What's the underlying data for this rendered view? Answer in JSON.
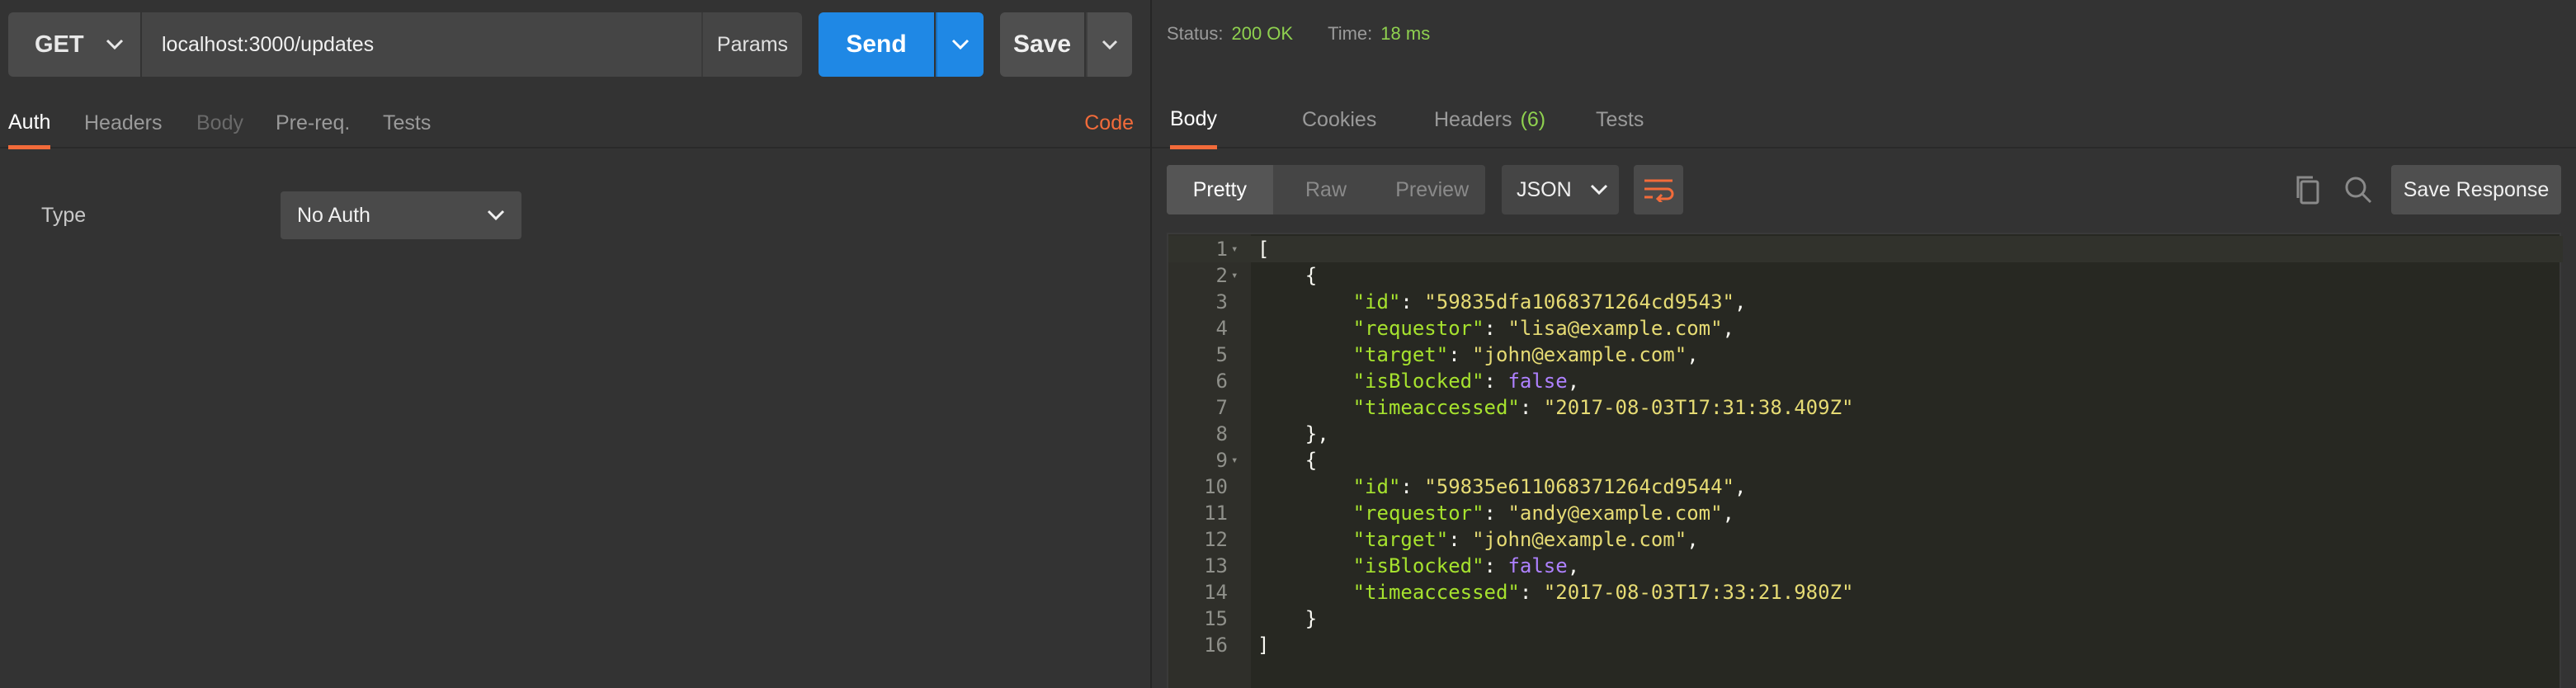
{
  "request": {
    "method": "GET",
    "url": "localhost:3000/updates",
    "params_label": "Params",
    "send_label": "Send",
    "save_label": "Save",
    "tabs": [
      {
        "label": "Auth",
        "state": "active"
      },
      {
        "label": "Headers",
        "state": "normal"
      },
      {
        "label": "Body",
        "state": "disabled"
      },
      {
        "label": "Pre-req.",
        "state": "normal"
      },
      {
        "label": "Tests",
        "state": "normal"
      }
    ],
    "code_link": "Code",
    "auth": {
      "type_label": "Type",
      "type_value": "No Auth"
    }
  },
  "response": {
    "status_label": "Status:",
    "status_value": "200 OK",
    "time_label": "Time:",
    "time_value": "18 ms",
    "tabs": [
      {
        "label": "Body",
        "state": "active"
      },
      {
        "label": "Cookies",
        "state": "normal"
      },
      {
        "label": "Headers",
        "state": "normal",
        "badge": "(6)"
      },
      {
        "label": "Tests",
        "state": "normal"
      }
    ],
    "view_modes": [
      "Pretty",
      "Raw",
      "Preview"
    ],
    "active_view": "Pretty",
    "format": "JSON",
    "save_response_label": "Save Response",
    "body_lines": [
      [
        [
          "p",
          "["
        ]
      ],
      [
        [
          "p",
          "    {"
        ]
      ],
      [
        [
          "p",
          "        "
        ],
        [
          "k",
          "\"id\""
        ],
        [
          "p",
          ": "
        ],
        [
          "s",
          "\"59835dfa1068371264cd9543\""
        ],
        [
          "p",
          ","
        ]
      ],
      [
        [
          "p",
          "        "
        ],
        [
          "k",
          "\"requestor\""
        ],
        [
          "p",
          ": "
        ],
        [
          "s",
          "\"lisa@example.com\""
        ],
        [
          "p",
          ","
        ]
      ],
      [
        [
          "p",
          "        "
        ],
        [
          "k",
          "\"target\""
        ],
        [
          "p",
          ": "
        ],
        [
          "s",
          "\"john@example.com\""
        ],
        [
          "p",
          ","
        ]
      ],
      [
        [
          "p",
          "        "
        ],
        [
          "k",
          "\"isBlocked\""
        ],
        [
          "p",
          ": "
        ],
        [
          "b",
          "false"
        ],
        [
          "p",
          ","
        ]
      ],
      [
        [
          "p",
          "        "
        ],
        [
          "k",
          "\"timeaccessed\""
        ],
        [
          "p",
          ": "
        ],
        [
          "s",
          "\"2017-08-03T17:31:38.409Z\""
        ]
      ],
      [
        [
          "p",
          "    },"
        ]
      ],
      [
        [
          "p",
          "    {"
        ]
      ],
      [
        [
          "p",
          "        "
        ],
        [
          "k",
          "\"id\""
        ],
        [
          "p",
          ": "
        ],
        [
          "s",
          "\"59835e611068371264cd9544\""
        ],
        [
          "p",
          ","
        ]
      ],
      [
        [
          "p",
          "        "
        ],
        [
          "k",
          "\"requestor\""
        ],
        [
          "p",
          ": "
        ],
        [
          "s",
          "\"andy@example.com\""
        ],
        [
          "p",
          ","
        ]
      ],
      [
        [
          "p",
          "        "
        ],
        [
          "k",
          "\"target\""
        ],
        [
          "p",
          ": "
        ],
        [
          "s",
          "\"john@example.com\""
        ],
        [
          "p",
          ","
        ]
      ],
      [
        [
          "p",
          "        "
        ],
        [
          "k",
          "\"isBlocked\""
        ],
        [
          "p",
          ": "
        ],
        [
          "b",
          "false"
        ],
        [
          "p",
          ","
        ]
      ],
      [
        [
          "p",
          "        "
        ],
        [
          "k",
          "\"timeaccessed\""
        ],
        [
          "p",
          ": "
        ],
        [
          "s",
          "\"2017-08-03T17:33:21.980Z\""
        ]
      ],
      [
        [
          "p",
          "    }"
        ]
      ],
      [
        [
          "p",
          "]"
        ]
      ]
    ],
    "foldable_lines": [
      1,
      2,
      9
    ]
  },
  "colors": {
    "accent": "#f26b3a",
    "send": "#1f88e5",
    "status_ok": "#8fd14f"
  }
}
